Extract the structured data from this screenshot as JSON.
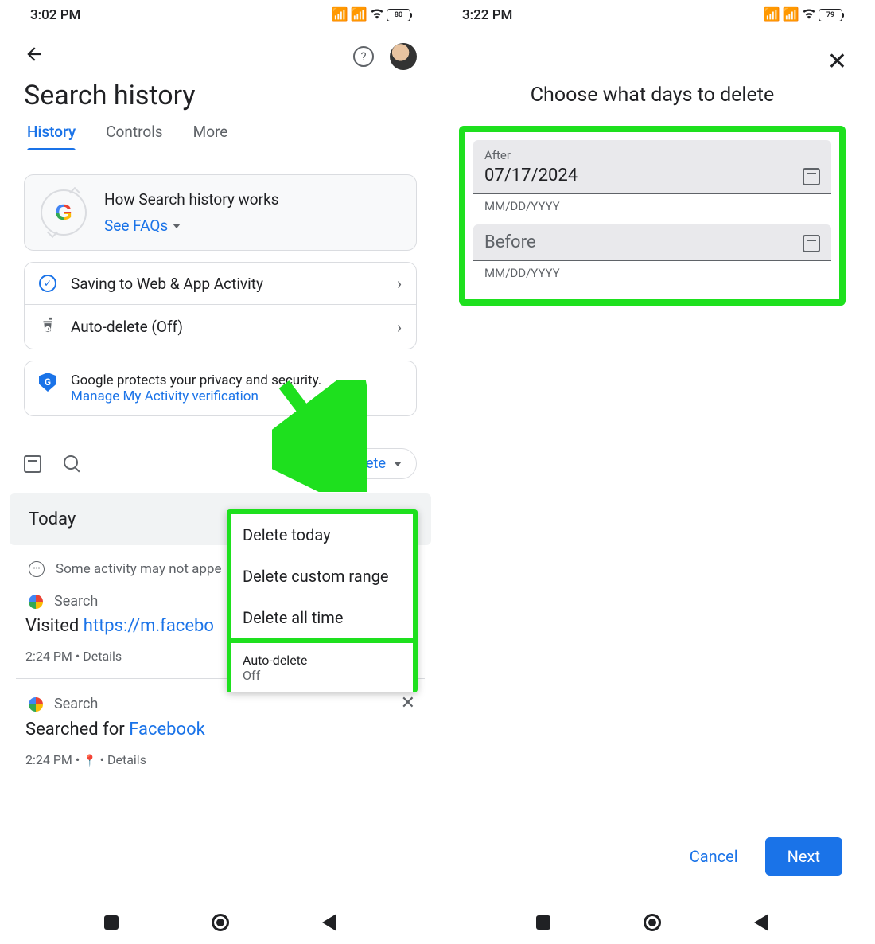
{
  "left": {
    "status": {
      "time": "3:02 PM",
      "battery": "80"
    },
    "page_title": "Search history",
    "tabs": [
      "History",
      "Controls",
      "More"
    ],
    "info": {
      "title": "How Search history works",
      "faqs": "See FAQs"
    },
    "settings": {
      "saving": "Saving to Web & App Activity",
      "autodelete": "Auto-delete (Off)"
    },
    "privacy": {
      "text": "Google protects your privacy and security.",
      "link": "Manage My Activity verification"
    },
    "delete_btn": "Delete",
    "section_today": "Today",
    "note": "Some activity may not appe",
    "item1": {
      "tag": "Search",
      "prefix": "Visited ",
      "linktext": "https://m.facebo",
      "meta": "2:24 PM • Details"
    },
    "item2": {
      "tag": "Search",
      "prefix": "Searched for ",
      "linktext": "Facebook",
      "meta_time": "2:24 PM • ",
      "meta_details": " • Details"
    },
    "menu": {
      "i1": "Delete today",
      "i2": "Delete custom range",
      "i3": "Delete all time",
      "i4": "Auto-delete",
      "i4s": "Off"
    }
  },
  "right": {
    "status": {
      "time": "3:22 PM",
      "battery": "79"
    },
    "title": "Choose what days to delete",
    "after_label": "After",
    "after_value": "07/17/2024",
    "after_hint": "MM/DD/YYYY",
    "before_label": "Before",
    "before_hint": "MM/DD/YYYY",
    "cancel": "Cancel",
    "next": "Next"
  }
}
